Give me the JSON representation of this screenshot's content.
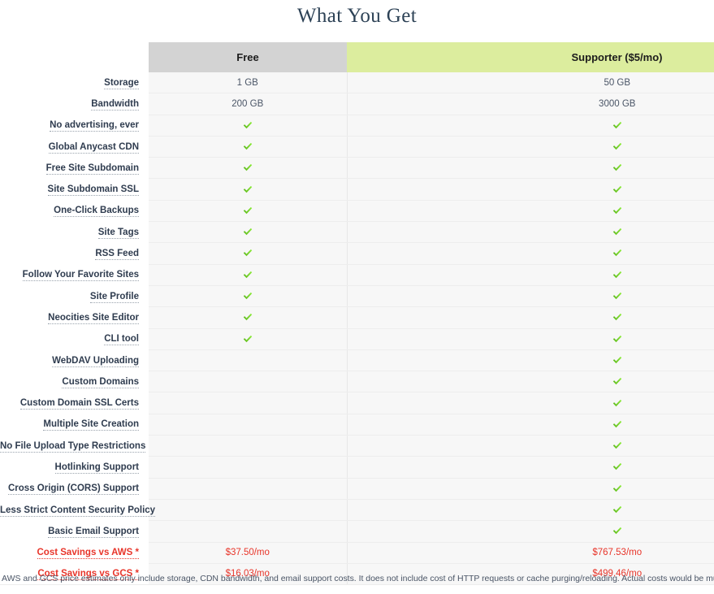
{
  "page": {
    "title": "What You Get",
    "footnote": "AWS and GCS price estimates only include storage, CDN bandwidth, and email support costs. It does not include cost of HTTP requests or cache purging/reloading. Actual costs would be much higher."
  },
  "colors": {
    "title": "#2d4256",
    "free_header_bg": "#d3d3d3",
    "supporter_header_bg": "#dced9e",
    "row_bg": "#f7f7f7",
    "check_green": "#64c321",
    "cost_red": "#e8352a",
    "label_text": "#2f3c4f"
  },
  "table": {
    "columns": [
      {
        "key": "label",
        "label": ""
      },
      {
        "key": "free",
        "label": "Free"
      },
      {
        "key": "supporter",
        "label": "Supporter ($5/mo)"
      }
    ],
    "rows": [
      {
        "label": "Storage",
        "free": "1 GB",
        "supporter": "50 GB",
        "type": "text"
      },
      {
        "label": "Bandwidth",
        "free": "200 GB",
        "supporter": "3000 GB",
        "type": "text"
      },
      {
        "label": "No advertising, ever",
        "free": "check",
        "supporter": "check",
        "type": "check"
      },
      {
        "label": "Global Anycast CDN",
        "free": "check",
        "supporter": "check",
        "type": "check"
      },
      {
        "label": "Free Site Subdomain",
        "free": "check",
        "supporter": "check",
        "type": "check"
      },
      {
        "label": "Site Subdomain SSL",
        "free": "check",
        "supporter": "check",
        "type": "check"
      },
      {
        "label": "One-Click Backups",
        "free": "check",
        "supporter": "check",
        "type": "check"
      },
      {
        "label": "Site Tags",
        "free": "check",
        "supporter": "check",
        "type": "check"
      },
      {
        "label": "RSS Feed",
        "free": "check",
        "supporter": "check",
        "type": "check"
      },
      {
        "label": "Follow Your Favorite Sites",
        "free": "check",
        "supporter": "check",
        "type": "check"
      },
      {
        "label": "Site Profile",
        "free": "check",
        "supporter": "check",
        "type": "check"
      },
      {
        "label": "Neocities Site Editor",
        "free": "check",
        "supporter": "check",
        "type": "check"
      },
      {
        "label": "CLI tool",
        "free": "check",
        "supporter": "check",
        "type": "check"
      },
      {
        "label": "WebDAV Uploading",
        "free": "",
        "supporter": "check",
        "type": "check"
      },
      {
        "label": "Custom Domains",
        "free": "",
        "supporter": "check",
        "type": "check"
      },
      {
        "label": "Custom Domain SSL Certs",
        "free": "",
        "supporter": "check",
        "type": "check"
      },
      {
        "label": "Multiple Site Creation",
        "free": "",
        "supporter": "check",
        "type": "check"
      },
      {
        "label": "No File Upload Type Restrictions",
        "free": "",
        "supporter": "check",
        "type": "check"
      },
      {
        "label": "Hotlinking Support",
        "free": "",
        "supporter": "check",
        "type": "check"
      },
      {
        "label": "Cross Origin (CORS) Support",
        "free": "",
        "supporter": "check",
        "type": "check"
      },
      {
        "label": "Less Strict Content Security Policy",
        "free": "",
        "supporter": "check",
        "type": "check"
      },
      {
        "label": "Basic Email Support",
        "free": "",
        "supporter": "check",
        "type": "check"
      },
      {
        "label": "Cost Savings vs AWS",
        "free": "$37.50/mo",
        "supporter": "$767.53/mo",
        "type": "cost",
        "footnote_marker": "*"
      },
      {
        "label": "Cost Savings vs GCS",
        "free": "$16.03/mo",
        "supporter": "$499.46/mo",
        "type": "cost",
        "footnote_marker": "*"
      }
    ]
  }
}
